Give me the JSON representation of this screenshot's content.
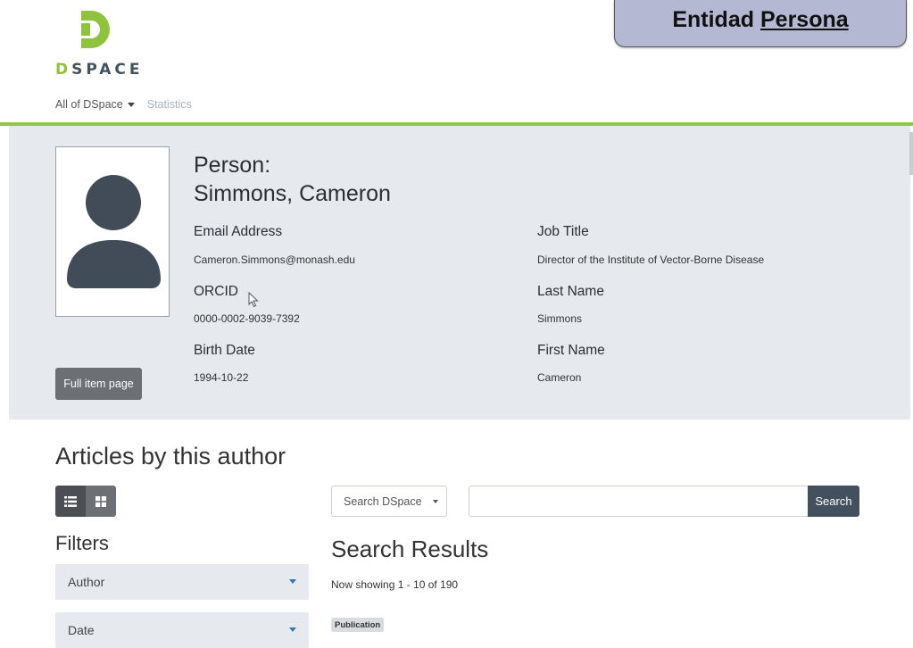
{
  "header": {
    "logo_text_initial": "D",
    "logo_text_rest": "SPACE",
    "nav": {
      "all_of_dspace": "All of DSpace",
      "statistics": "Statistics"
    }
  },
  "banner": {
    "prefix": "Entidad",
    "emphasis": "Persona"
  },
  "entity": {
    "type_label": "Person:",
    "name": "Simmons, Cameron",
    "full_item_button": "Full item page",
    "fields": {
      "email": {
        "label": "Email Address",
        "value": "Cameron.Simmons@monash.edu"
      },
      "orcid": {
        "label": "ORCID",
        "value": "0000-0002-9039-7392"
      },
      "birth_date": {
        "label": "Birth Date",
        "value": "1994-10-22"
      },
      "job_title": {
        "label": "Job Title",
        "value": "Director of the Institute of Vector-Borne Disease"
      },
      "last_name": {
        "label": "Last Name",
        "value": "Simmons"
      },
      "first_name": {
        "label": "First Name",
        "value": "Cameron"
      }
    }
  },
  "articles": {
    "title": "Articles by this author",
    "filters_title": "Filters",
    "facets": [
      "Author",
      "Date"
    ],
    "search": {
      "scope_selected": "Search DSpace",
      "query_value": "",
      "button": "Search"
    },
    "results_title": "Search Results",
    "showing": "Now showing 1 - 10 of 190",
    "first_result_type": "Publication"
  },
  "colors": {
    "brand_green": "#92c83e",
    "brand_dark": "#43515f",
    "banner_bg": "#b5b8d3",
    "panel_bg": "#e6e9ee"
  },
  "icons": [
    "dspace-logo-icon",
    "caret-down-icon",
    "user-avatar-icon",
    "list-view-icon",
    "grid-view-icon",
    "mouse-cursor-icon"
  ]
}
